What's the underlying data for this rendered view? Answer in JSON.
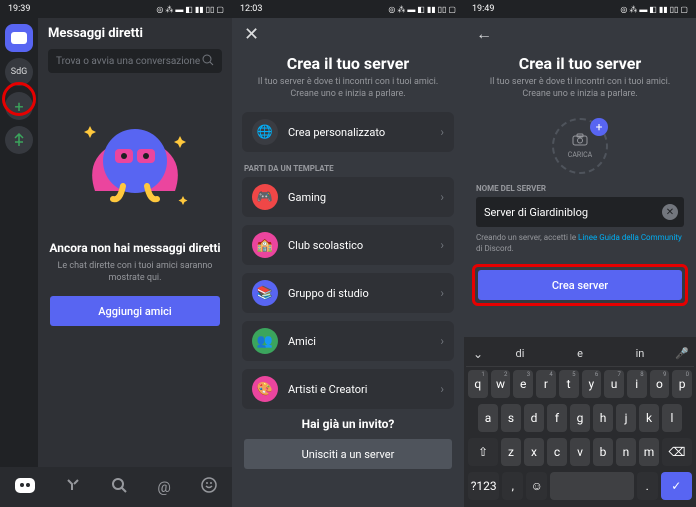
{
  "screen1": {
    "time": "19:39",
    "dm_title": "Messaggi diretti",
    "search_placeholder": "Trova o avvia una conversazione",
    "server_sdg": "SdG",
    "empty_title": "Ancora non hai messaggi diretti",
    "empty_sub": "Le chat dirette con i tuoi amici saranno mostrate qui.",
    "add_friends": "Aggiungi amici"
  },
  "screen2": {
    "time": "12:03",
    "title": "Crea il tuo server",
    "subtitle": "Il tuo server è dove ti incontri con i tuoi amici. Creane uno e inizia a parlare.",
    "custom": "Crea personalizzato",
    "template_header": "Parti da un template",
    "templates": [
      "Gaming",
      "Club scolastico",
      "Gruppo di studio",
      "Amici",
      "Artisti e Creatori"
    ],
    "invite_title": "Hai già un invito?",
    "join_btn": "Unisciti a un server"
  },
  "screen3": {
    "time": "19:49",
    "title": "Crea il tuo server",
    "subtitle": "Il tuo server è dove ti incontri con i tuoi amici. Creane uno e inizia a parlare.",
    "upload_label": "CARICA",
    "name_label": "Nome del server",
    "name_value": "Server di Giardiniblog",
    "terms_pre": "Creando un server, accetti le ",
    "terms_link": "Linee Guida della Community",
    "terms_post": " di Discord.",
    "create_btn": "Crea server",
    "suggestions": [
      "di",
      "e",
      "in"
    ],
    "kb_row1": [
      "q",
      "w",
      "e",
      "r",
      "t",
      "y",
      "u",
      "i",
      "o",
      "p"
    ],
    "kb_row2": [
      "a",
      "s",
      "d",
      "f",
      "g",
      "h",
      "j",
      "k",
      "l"
    ],
    "kb_row3": [
      "z",
      "x",
      "c",
      "v",
      "b",
      "n",
      "m"
    ]
  }
}
